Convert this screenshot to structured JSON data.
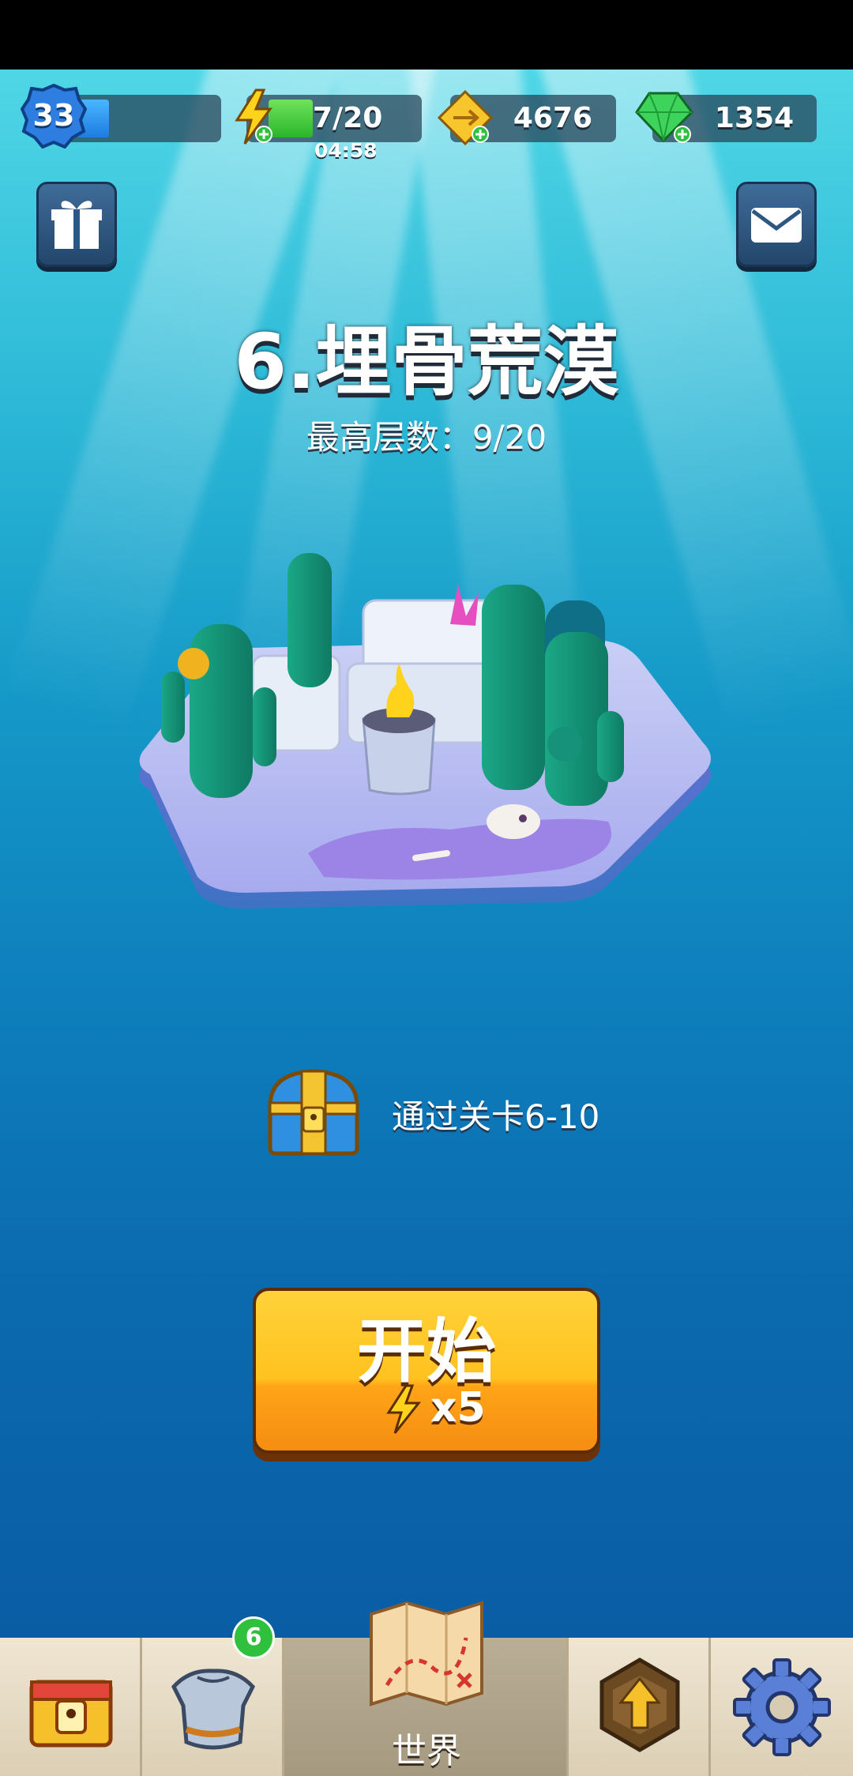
{
  "player": {
    "level": "33"
  },
  "resources": {
    "energy": {
      "value": "7/20",
      "timer": "04:58",
      "icon": "lightning-bolt-icon"
    },
    "gold": {
      "value": "4676",
      "icon": "gold-coin-icon"
    },
    "gems": {
      "value": "1354",
      "icon": "green-gem-icon"
    }
  },
  "buttons": {
    "gift": "gift-icon",
    "mail": "mail-icon"
  },
  "stage": {
    "title": "6.埋骨荒漠",
    "best_floor": "最高层数：9/20"
  },
  "reward": {
    "text": "通过关卡6-10",
    "icon": "treasure-chest-icon"
  },
  "start_button": {
    "label": "开始",
    "cost": "x5"
  },
  "nav": {
    "items": [
      {
        "name": "shop",
        "icon": "locked-chest-icon"
      },
      {
        "name": "equipment",
        "icon": "armor-icon",
        "badge": "6"
      },
      {
        "name": "world",
        "icon": "treasure-map-icon",
        "label": "世界"
      },
      {
        "name": "upgrade",
        "icon": "upgrade-arrow-icon"
      },
      {
        "name": "settings",
        "icon": "gear-icon"
      }
    ]
  },
  "colors": {
    "accent": "#ffc21f",
    "sea_top": "#4fd6e6",
    "sea_bottom": "#0a5da4"
  }
}
